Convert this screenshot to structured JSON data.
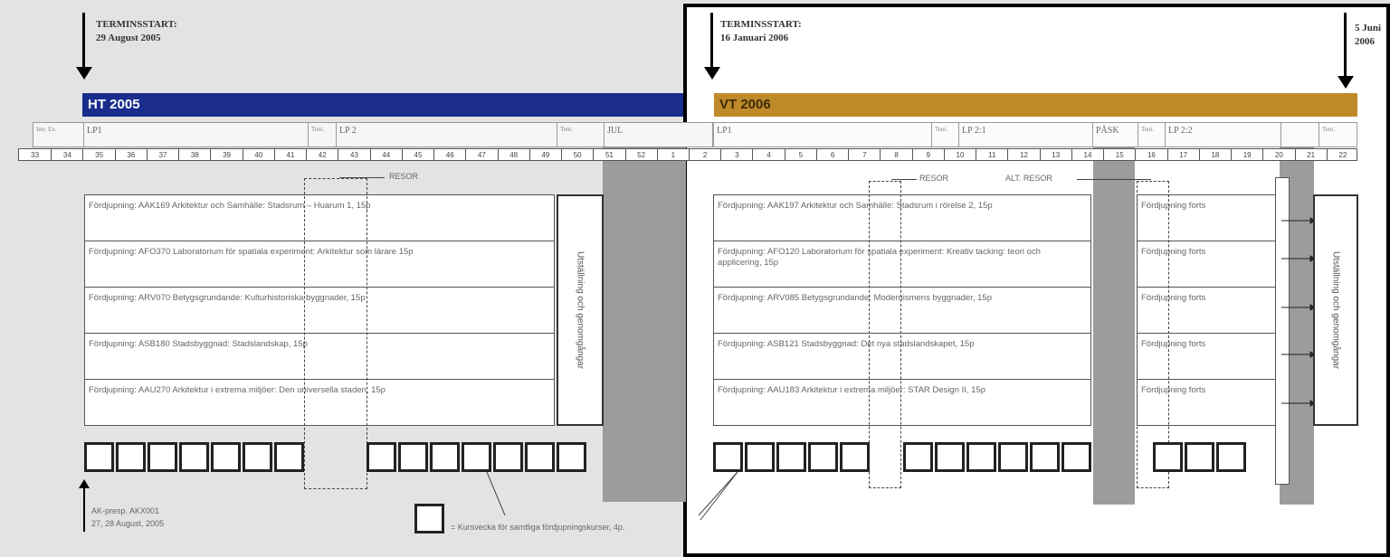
{
  "ht": {
    "terminsstart_label": "TERMINSSTART:",
    "terminsstart_date": "29 August 2005",
    "bar_label": "HT 2005"
  },
  "vt": {
    "terminsstart_label": "TERMINSSTART:",
    "terminsstart_date": "16 Januari 2006",
    "bar_label": "VT 2006",
    "end_label_1": "5 Juni",
    "end_label_2": "2006"
  },
  "weeks": [
    "33",
    "34",
    "35",
    "36",
    "37",
    "38",
    "39",
    "40",
    "41",
    "42",
    "43",
    "44",
    "45",
    "46",
    "47",
    "48",
    "49",
    "50",
    "51",
    "52",
    "1",
    "2",
    "3",
    "4",
    "5",
    "6",
    "7",
    "8",
    "9",
    "10",
    "11",
    "12",
    "13",
    "14",
    "15",
    "16",
    "17",
    "18",
    "19",
    "20",
    "21",
    "22"
  ],
  "lp_ht": [
    {
      "label": "LP1",
      "small": "Intr. Ex."
    },
    {
      "label": "LP 2",
      "small": "Tent."
    },
    {
      "label": "JUL",
      "small": "Tent."
    }
  ],
  "lp_vt": [
    {
      "label": "LP1",
      "small": ""
    },
    {
      "label": "LP 2:1",
      "small": "Tent."
    },
    {
      "label": "PÅSK",
      "small": ""
    },
    {
      "label": "LP 2:2",
      "small": "Tent."
    },
    {
      "label": "",
      "small": "Tent."
    }
  ],
  "resor_ht": "RESOR",
  "resor_vt_1": "RESOR",
  "resor_vt_2": "ALT. RESOR",
  "courses_ht": [
    "Fördjupning: AAK169 Arkitektur och Samhälle: Stadsrum – Huarum 1, 15p",
    "Fördjupning: AFO370 Laboratorium för spatiala experiment: Arkitektur som lärare 15p",
    "Fördjupning: ARV070 Betygsgrundande: Kulturhistoriska byggnader, 15p",
    "Fördjupning: ASB180 Stadsbyggnad: Stadslandskap, 15p",
    "Fördjupning: AAU270 Arkitektur i extrema miljöer: Den universella staden, 15p"
  ],
  "courses_vt": [
    "Fördjupning: AAK197 Arkitektur och Samhälle: Stadsrum i rörelse 2, 15p",
    "Fördjupning: AFO120 Laboratorium för spatiala experiment: Kreativ tacking: teori och applicering, 15p",
    "Fördjupning: ARV085 Betygsgrundande: Modernismens byggnader, 15p",
    "Fördjupning: ASB121 Stadsbyggnad: Det nya stadslandskapet, 15p",
    "Fördjupning: AAU183 Arkitektur i extrema miljöer: STAR Design II, 15p"
  ],
  "cont_label": "Fördjupning forts",
  "vbox_ht": "Utställning och genomgångar",
  "vbox_vt": "Utställning och genomgångar",
  "ak_note_1": "AK-presp. AKX001",
  "ak_note_2": "27, 28 August, 2005",
  "legend_text": "= Kursvecka för samtliga fördjupningskurser, 4p."
}
